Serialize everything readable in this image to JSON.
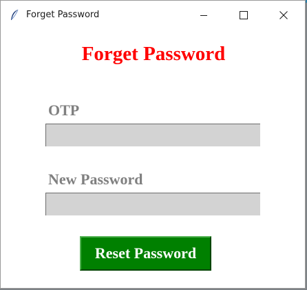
{
  "window": {
    "title": "Forget Password",
    "controls": {
      "minimize": "minimize-icon",
      "maximize": "maximize-icon",
      "close": "close-icon"
    },
    "icon": "feather-icon"
  },
  "form": {
    "heading": "Forget Password",
    "otp_label": "OTP",
    "otp_value": "",
    "new_password_label": "New Password",
    "new_password_value": "",
    "submit_label": "Reset Password"
  },
  "colors": {
    "heading": "#ff0000",
    "label": "#808080",
    "field_bg": "#d3d3d3",
    "button_bg": "#008000",
    "button_text": "#ffffff"
  }
}
